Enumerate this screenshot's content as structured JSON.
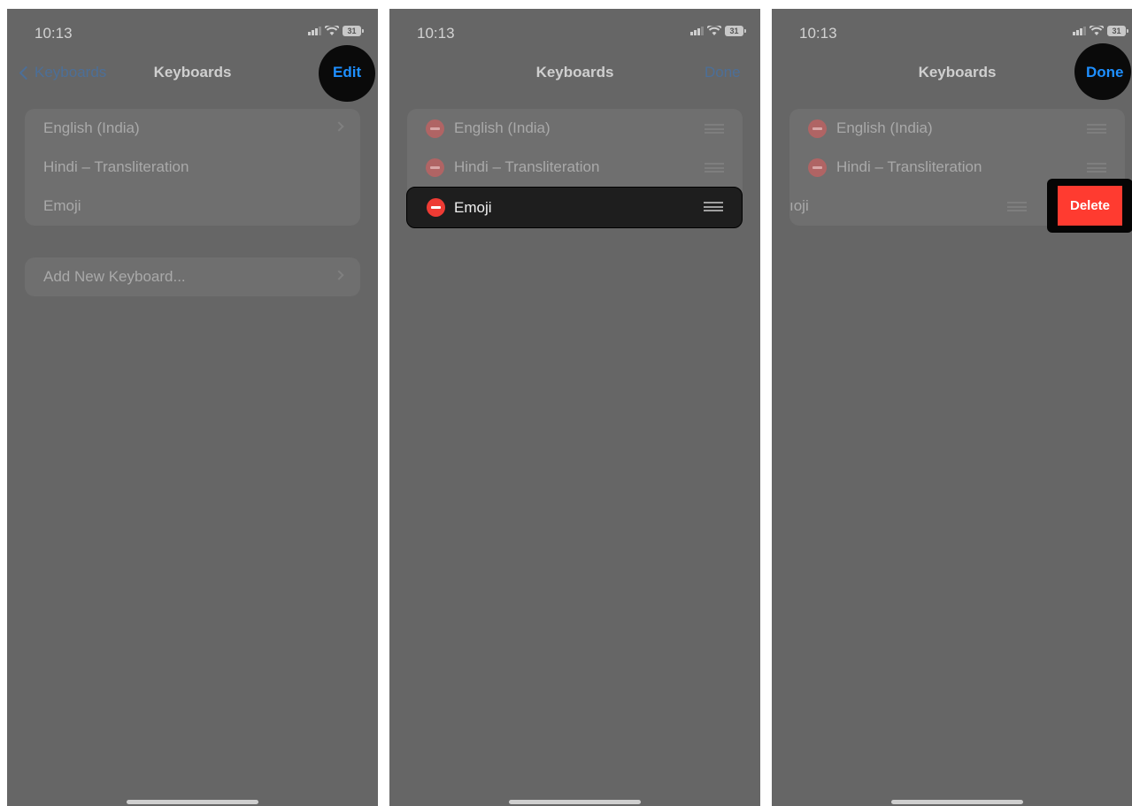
{
  "status": {
    "time": "10:13",
    "battery": "31"
  },
  "panel1": {
    "back_label": "Keyboards",
    "title": "Keyboards",
    "action": "Edit",
    "keyboards": [
      "English (India)",
      "Hindi – Transliteration",
      "Emoji"
    ],
    "add_label": "Add New Keyboard..."
  },
  "panel2": {
    "title": "Keyboards",
    "action": "Done",
    "keyboards": [
      "English (India)",
      "Hindi – Transliteration"
    ],
    "dragged": "Emoji"
  },
  "panel3": {
    "title": "Keyboards",
    "action": "Done",
    "keyboards": [
      "English (India)",
      "Hindi – Transliteration"
    ],
    "swiped_partial": "ıoji",
    "delete_label": "Delete"
  },
  "colors": {
    "accent": "#1e8fff",
    "delete": "#ff3b30",
    "dim_overlay": "#666666"
  }
}
